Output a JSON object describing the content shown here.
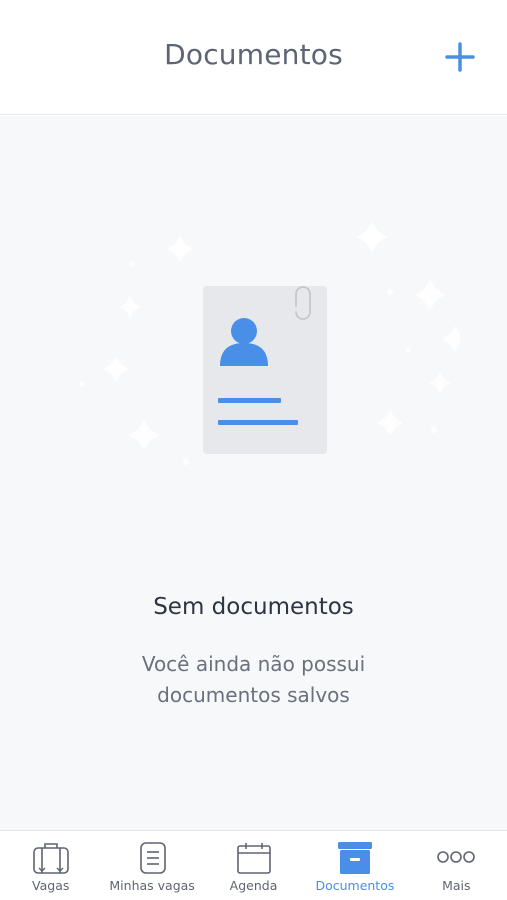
{
  "header": {
    "title": "Documentos",
    "add_icon": "plus-icon"
  },
  "empty_state": {
    "illustration": "document-profile-illustration",
    "title": "Sem documentos",
    "description": "Você ainda não possui documentos salvos"
  },
  "tabbar": {
    "items": [
      {
        "label": "Vagas",
        "icon": "suitcase-icon",
        "active": false
      },
      {
        "label": "Minhas vagas",
        "icon": "document-list-icon",
        "active": false
      },
      {
        "label": "Agenda",
        "icon": "calendar-icon",
        "active": false
      },
      {
        "label": "Documentos",
        "icon": "archive-box-icon",
        "active": true
      },
      {
        "label": "Mais",
        "icon": "more-dots-icon",
        "active": false
      }
    ]
  },
  "colors": {
    "accent": "#4a8fe7",
    "background": "#f7f8fa",
    "text_muted": "#6a707c"
  }
}
